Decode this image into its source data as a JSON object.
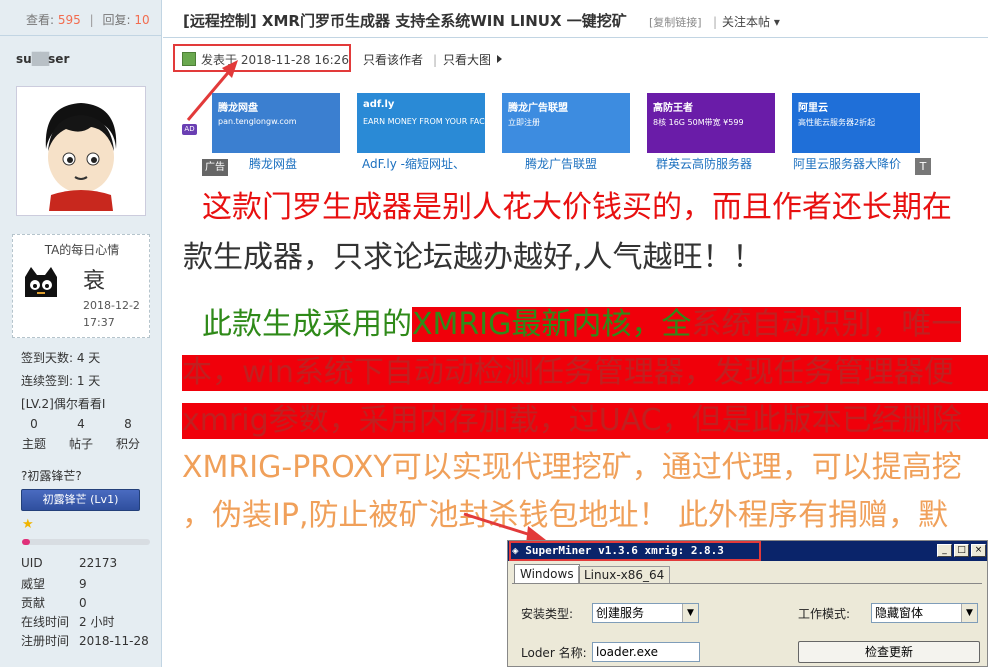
{
  "topstats": {
    "view_label": "查看:",
    "view_count": "595",
    "reply_label": "回复:",
    "reply_count": "10",
    "sep": "|"
  },
  "user": {
    "name_prefix": "su",
    "name_blur": "██",
    "name_suffix": "ser",
    "mood_title": "TA的每日心情",
    "mood_word": "衰",
    "mood_date1": "2018-12-2",
    "mood_date2": "17:37",
    "checkin_days": "签到天数: 4 天",
    "consecutive": "连续签到: 1 天",
    "level_text": "[LV.2]偶尔看看I",
    "counts": [
      {
        "value": "0",
        "label": "主题"
      },
      {
        "value": "4",
        "label": "帖子"
      },
      {
        "value": "8",
        "label": "积分"
      }
    ],
    "rank_q": "?初露锋芒?",
    "rank_btn": "初露锋芒 (Lv1)",
    "rank_progress": 0.06,
    "info": [
      {
        "k": "UID",
        "v": "22173"
      },
      {
        "k": "威望",
        "v": "9"
      },
      {
        "k": "贡献",
        "v": "0"
      },
      {
        "k": "在线时间",
        "v": "2 小时"
      },
      {
        "k": "注册时间",
        "v": "2018-11-28"
      }
    ]
  },
  "thread": {
    "title": "[远程控制] XMR门罗币生成器 支持全系统WIN LINUX 一键挖矿",
    "copy_link": "[复制链接]",
    "follow": "关注本帖",
    "follow_sep": "|",
    "posted": "发表于 2018-11-28 16:26",
    "author_only": "只看该作者",
    "view_big": "只看大图",
    "sep": "|"
  },
  "ads": {
    "ad_icon": "AD",
    "ad_label": "广告",
    "t_badge": "T",
    "items": [
      {
        "caption": "腾龙网盘",
        "title": "腾龙网盘",
        "sub": "pan.tenglongw.com",
        "bg": "#3b7fd0"
      },
      {
        "caption": "AdF.ly -缩短网址、",
        "title": "adf.ly",
        "sub": "EARN MONEY FROM YOUR FACEBOOK",
        "bg": "#2a8ad6"
      },
      {
        "caption": "腾龙广告联盟",
        "title": "腾龙广告联盟",
        "sub": "立即注册",
        "bg": "#3d8ce0"
      },
      {
        "caption": "群英云高防服务器",
        "title": "高防王者",
        "sub": "8核 16G 50M带宽 ¥599",
        "bg": "#6a1ca8"
      },
      {
        "caption": "阿里云服务器大降价",
        "title": "阿里云",
        "sub": "高性能云服务器2折起",
        "bg": "#1f6fd8"
      }
    ]
  },
  "body": {
    "line1": "这款门罗生成器是别人花大价钱买的，而且作者还长期在",
    "line2": "款生成器，只求论坛越办越好,人气越旺！！",
    "line3a": "此款生成采用的",
    "line3b": "XMRIG最新内核，全",
    "line3c": "系统自动识别，唯一",
    "line4": "本，win系统下自动动检测任务管理器，发现任务管理器便",
    "line5": "xmrig参数，采用内存加载，过UAC，但是此版本已经删除",
    "line6": "XMRIG-PROXY可以实现代理挖矿，通过代理，可以提高挖",
    "line7": "，伪装IP,防止被矿池封杀钱包地址！  此外程序有捐赠，默"
  },
  "window": {
    "title": "SuperMiner v1.3.6  xmrig: 2.8.3",
    "tabs": [
      "Windows",
      "Linux-x86_64"
    ],
    "install_label": "安装类型:",
    "install_value": "创建服务",
    "mode_label": "工作模式:",
    "mode_value": "隐藏窗体",
    "loader_label": "Loder 名称:",
    "loader_value": "loader.exe",
    "check_update": "检查更新",
    "btn_min": "_",
    "btn_max": "□",
    "btn_close": "×"
  },
  "colors": {
    "accent_red": "#e23a3a",
    "link_blue": "#1a6fbf",
    "body_red": "#e81010",
    "body_green": "#2f8a19",
    "body_orange": "#f0a05a"
  }
}
